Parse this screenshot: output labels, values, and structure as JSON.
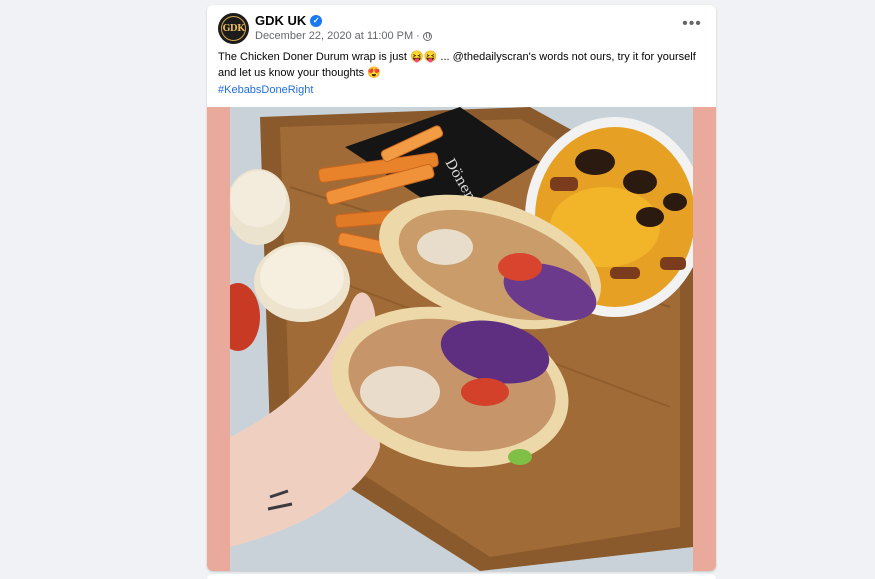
{
  "post": {
    "page_name": "GDK UK",
    "avatar_text": "GDK",
    "timestamp": "December 22, 2020 at 11:00 PM",
    "separator": "·",
    "text": "The Chicken Doner Durum wrap is just 😝😝 ... @thedailyscran's words not ours, try it for yourself and let us know your thoughts 😍",
    "hashtag": "#KebabsDoneRight",
    "more_label": "•••",
    "image_alt": "Chicken Doner Durum wrap held in hand with fries and loaded fries",
    "box_brand": "Döner Kebab"
  },
  "icons": {
    "verified": "verified-badge-icon",
    "audience": "globe-icon",
    "more": "more-options-icon"
  },
  "colors": {
    "accent": "#1877f2",
    "link": "#216fdb",
    "image_bg": "#e9a99b"
  }
}
